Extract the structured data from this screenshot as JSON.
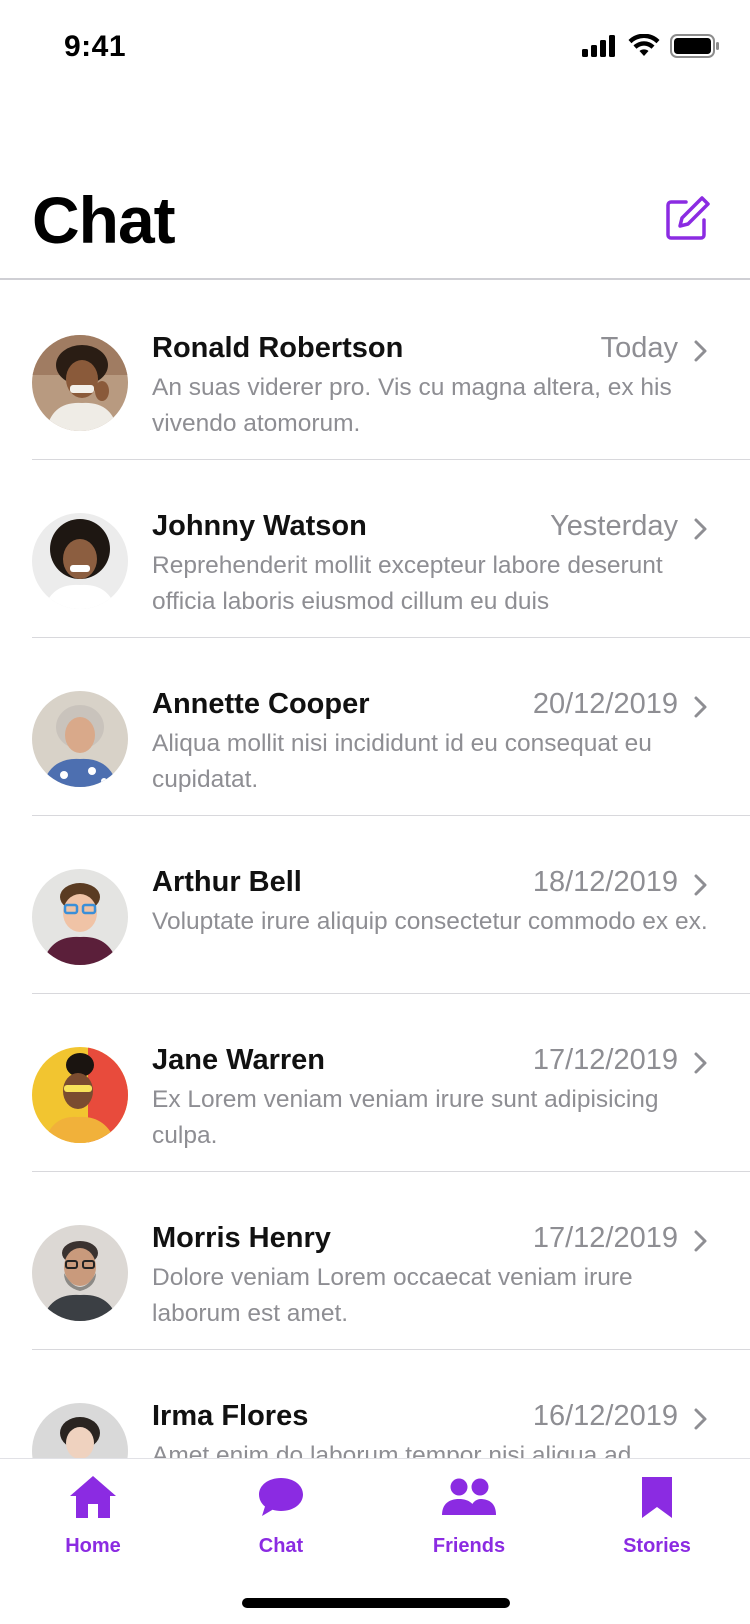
{
  "status_bar": {
    "time": "9:41"
  },
  "header": {
    "title": "Chat"
  },
  "colors": {
    "accent": "#8b2be2",
    "muted_text": "#8e8e93",
    "divider": "#d8d8dc"
  },
  "chats": [
    {
      "name": "Ronald Robertson",
      "date": "Today",
      "preview": "An suas viderer pro. Vis cu magna altera, ex his vivendo atomorum."
    },
    {
      "name": "Johnny Watson",
      "date": "Yesterday",
      "preview": "Reprehenderit mollit excepteur labore deserunt officia laboris eiusmod cillum eu duis"
    },
    {
      "name": "Annette Cooper",
      "date": "20/12/2019",
      "preview": "Aliqua mollit nisi incididunt id eu consequat eu cupidatat."
    },
    {
      "name": "Arthur Bell",
      "date": "18/12/2019",
      "preview": "Voluptate irure aliquip consectetur commodo ex ex."
    },
    {
      "name": "Jane Warren",
      "date": "17/12/2019",
      "preview": "Ex Lorem veniam veniam irure sunt adipisicing culpa."
    },
    {
      "name": "Morris Henry",
      "date": "17/12/2019",
      "preview": "Dolore veniam Lorem occaecat veniam irure laborum est amet."
    },
    {
      "name": "Irma Flores",
      "date": "16/12/2019",
      "preview": "Amet enim do laborum tempor nisi aliqua ad"
    }
  ],
  "tabs": [
    {
      "label": "Home",
      "icon": "home-icon"
    },
    {
      "label": "Chat",
      "icon": "chat-bubble-icon"
    },
    {
      "label": "Friends",
      "icon": "friends-icon"
    },
    {
      "label": "Stories",
      "icon": "bookmark-icon"
    }
  ]
}
